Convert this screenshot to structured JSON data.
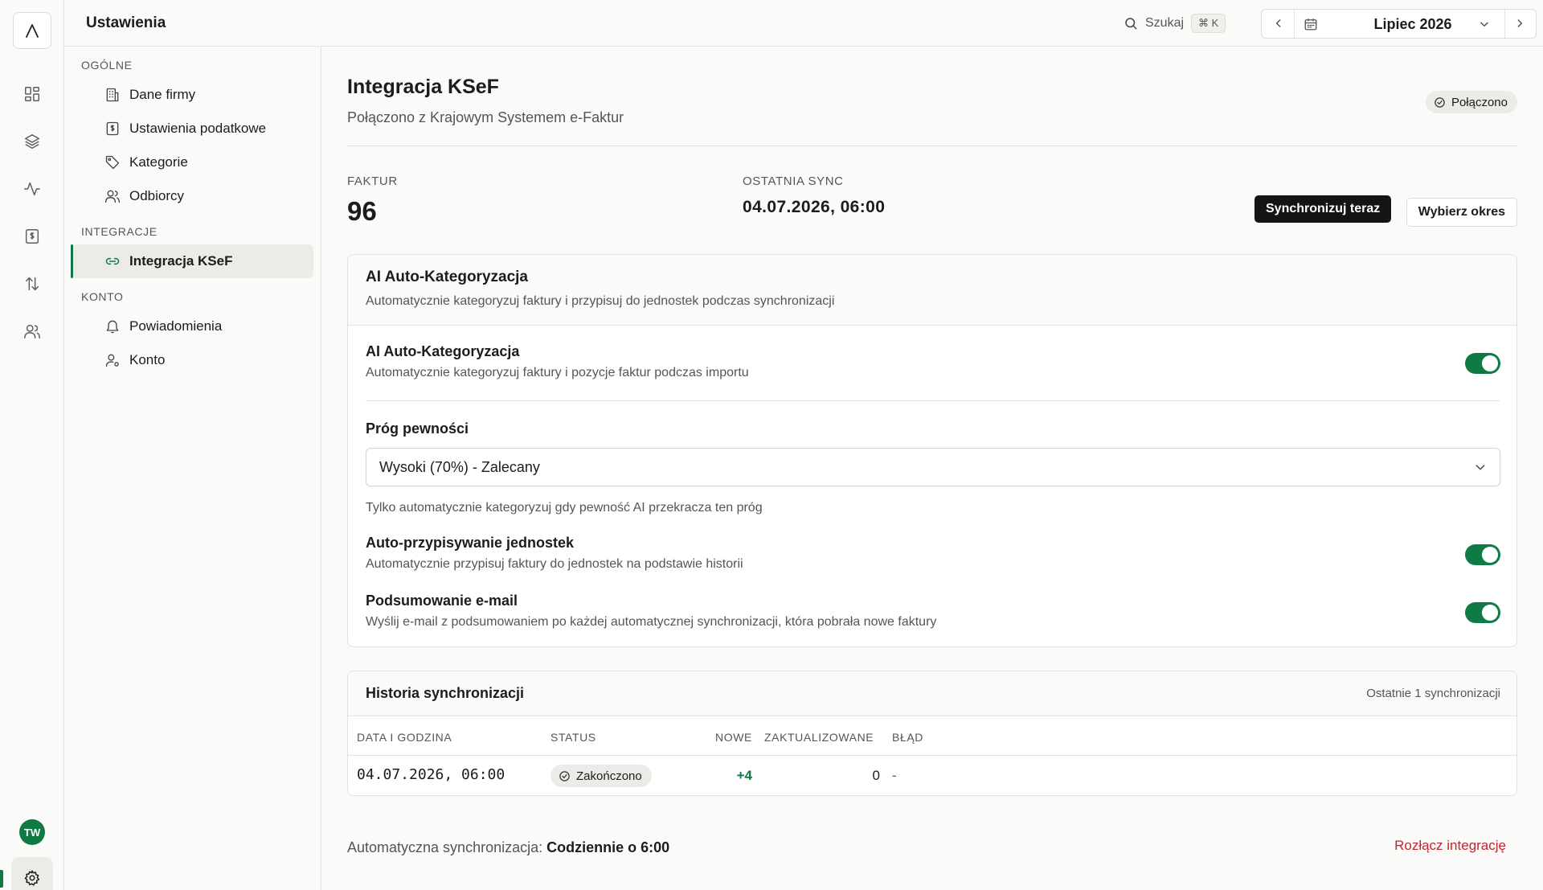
{
  "header": {
    "title": "Ustawienia",
    "search_label": "Szukaj",
    "search_shortcut": "⌘ K",
    "period": "Lipiec 2026"
  },
  "rail": {
    "items": [
      "dashboard-icon",
      "layers-icon",
      "activity-icon",
      "invoice-icon",
      "transfers-icon",
      "users-icon"
    ],
    "avatar_initials": "TW",
    "accent": "#0f7a44"
  },
  "settings_nav": {
    "sections": [
      {
        "label": "OGÓLNE",
        "items": [
          "Dane firmy",
          "Ustawienia podatkowe",
          "Kategorie",
          "Odbiorcy"
        ]
      },
      {
        "label": "INTEGRACJE",
        "items": [
          "Integracja KSeF"
        ]
      },
      {
        "label": "KONTO",
        "items": [
          "Powiadomienia",
          "Konto"
        ]
      }
    ],
    "active": "Integracja KSeF"
  },
  "page": {
    "title": "Integracja KSeF",
    "subtitle": "Połączono z Krajowym Systemem e-Faktur",
    "status": "Połączono"
  },
  "stats": {
    "invoices_label": "FAKTUR",
    "invoices_value": "96",
    "last_sync_label": "OSTATNIA SYNC",
    "last_sync_value": "04.07.2026, 06:00"
  },
  "actions": {
    "sync_now": "Synchronizuj teraz",
    "choose_period": "Wybierz okres"
  },
  "ai_card": {
    "title": "AI Auto-Kategoryzacja",
    "subtitle": "Automatycznie kategoryzuj faktury i przypisuj do jednostek podczas synchronizacji",
    "auto_cat_title": "AI Auto-Kategoryzacja",
    "auto_cat_desc": "Automatycznie kategoryzuj faktury i pozycje faktur podczas importu",
    "auto_cat_on": true,
    "threshold_label": "Próg pewności",
    "threshold_value": "Wysoki (70%) - Zalecany",
    "threshold_hint": "Tylko automatycznie kategoryzuj gdy pewność AI przekracza ten próg",
    "units_title": "Auto-przypisywanie jednostek",
    "units_desc": "Automatycznie przypisuj faktury do jednostek na podstawie historii",
    "units_on": true,
    "email_title": "Podsumowanie e-mail",
    "email_desc": "Wyślij e-mail z podsumowaniem po każdej automatycznej synchronizacji, która pobrała nowe faktury",
    "email_on": true
  },
  "history": {
    "title": "Historia synchronizacji",
    "meta": "Ostatnie 1 synchronizacji",
    "columns": [
      "DATA I GODZINA",
      "STATUS",
      "NOWE",
      "ZAKTUALIZOWANE",
      "BŁĄD"
    ],
    "rows": [
      {
        "datetime": "04.07.2026, 06:00",
        "status": "Zakończono",
        "new": "+4",
        "updated": "0",
        "error": "-"
      }
    ]
  },
  "footer": {
    "auto_sync_label": "Automatyczna synchronizacja:",
    "auto_sync_value": "Codziennie o 6:00",
    "disconnect": "Rozłącz integrację"
  }
}
